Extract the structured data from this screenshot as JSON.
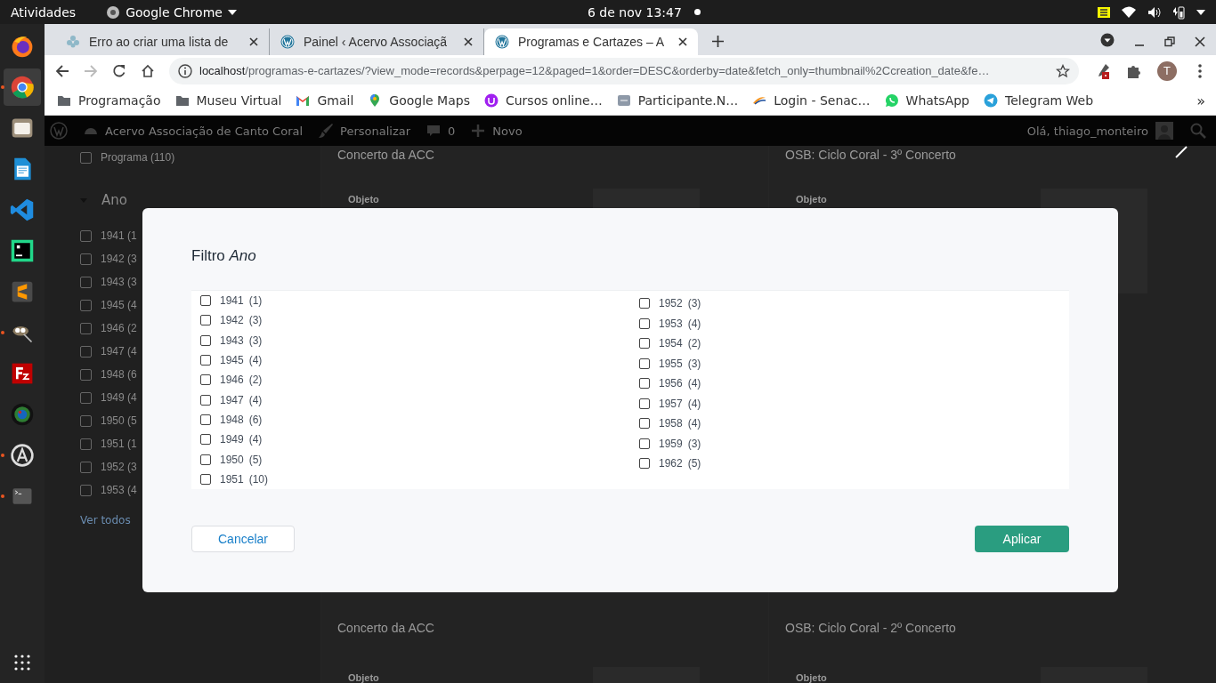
{
  "system_bar": {
    "activities": "Atividades",
    "app_menu": "Google Chrome",
    "clock": "6 de nov  13:47"
  },
  "dock": [
    {
      "kind": "firefox",
      "running": false,
      "selected": false
    },
    {
      "kind": "chrome",
      "running": true,
      "selected": true
    },
    {
      "kind": "files",
      "running": false,
      "selected": false
    },
    {
      "kind": "writer",
      "running": false,
      "selected": false
    },
    {
      "kind": "vscode",
      "running": false,
      "selected": false
    },
    {
      "kind": "pycharm",
      "running": false,
      "selected": false
    },
    {
      "kind": "sublime",
      "running": false,
      "selected": false
    },
    {
      "kind": "gimp",
      "running": true,
      "selected": false
    },
    {
      "kind": "filezilla",
      "running": false,
      "selected": false
    },
    {
      "kind": "camera",
      "running": false,
      "selected": false
    },
    {
      "kind": "software",
      "running": true,
      "selected": false
    },
    {
      "kind": "terminal",
      "running": true,
      "selected": false
    }
  ],
  "tabs": [
    {
      "kind": "flower",
      "title": "Erro ao criar uma lista de",
      "selected": false
    },
    {
      "kind": "wordpress",
      "title": "Painel ‹ Acervo Associaçã",
      "selected": false
    },
    {
      "kind": "wordpress",
      "title": "Programas e Cartazes – A",
      "selected": true
    }
  ],
  "toolbar": {
    "url_host": "localhost",
    "url_path": "/programas-e-cartazes/?view_mode=records&perpage=12&paged=1&order=DESC&orderby=date&fetch_only=thumbnail%2Ccreation_date&fe…",
    "profile": "T"
  },
  "bookmarks": [
    {
      "kind": "folder",
      "label": "Programação"
    },
    {
      "kind": "folder",
      "label": "Museu Virtual"
    },
    {
      "kind": "gmail",
      "label": "Gmail"
    },
    {
      "kind": "maps",
      "label": "Google Maps"
    },
    {
      "kind": "course",
      "label": "Cursos online…"
    },
    {
      "kind": "site",
      "label": "Participante.N…"
    },
    {
      "kind": "senac",
      "label": "Login - Senac…"
    },
    {
      "kind": "whatsapp",
      "label": "WhatsApp"
    },
    {
      "kind": "telegram",
      "label": "Telegram Web"
    }
  ],
  "bookmarks_more": "»",
  "admin_bar": {
    "site": "Acervo Associação de Canto Coral",
    "customize": "Personalizar",
    "comments": "0",
    "new": "Novo",
    "greeting": "Olá, thiago_monteiro"
  },
  "sidebar": {
    "program_filter": {
      "label": "Programa (110)",
      "checked": false
    },
    "section": "Ano",
    "expanded": true,
    "years": [
      {
        "label": "1941 (1",
        "checked": false
      },
      {
        "label": "1942 (3",
        "checked": false
      },
      {
        "label": "1943 (3",
        "checked": false
      },
      {
        "label": "1945 (4",
        "checked": false
      },
      {
        "label": "1946 (2",
        "checked": false
      },
      {
        "label": "1947 (4",
        "checked": false
      },
      {
        "label": "1948 (6",
        "checked": false
      },
      {
        "label": "1949 (4",
        "checked": false
      },
      {
        "label": "1950 (5",
        "checked": false
      },
      {
        "label": "1951 (1",
        "checked": false
      },
      {
        "label": "1952 (3",
        "checked": false
      },
      {
        "label": "1953 (4",
        "checked": false
      }
    ],
    "see_all": "Ver todos"
  },
  "cards": [
    {
      "title": "Concerto da ACC",
      "field_label": "Objeto"
    },
    {
      "title": "OSB: Ciclo Coral - 3º Concerto",
      "field_label": "Objeto"
    },
    {
      "title": "Concerto da ACC",
      "field_label": "Objeto"
    },
    {
      "title": "OSB: Ciclo Coral - 2º Concerto",
      "field_label": "Objeto"
    }
  ],
  "modal": {
    "title": "Filtro *Ano*",
    "option_columns": [
      [
        {
          "year": "1941",
          "count": "(1)",
          "checked": false
        },
        {
          "year": "1942",
          "count": "(3)",
          "checked": false
        },
        {
          "year": "1943",
          "count": "(3)",
          "checked": false
        },
        {
          "year": "1945",
          "count": "(4)",
          "checked": false
        },
        {
          "year": "1946",
          "count": "(2)",
          "checked": false
        },
        {
          "year": "1947",
          "count": "(4)",
          "checked": false
        },
        {
          "year": "1948",
          "count": "(6)",
          "checked": false
        },
        {
          "year": "1949",
          "count": "(4)",
          "checked": false
        },
        {
          "year": "1950",
          "count": "(5)",
          "checked": false
        },
        {
          "year": "1951",
          "count": "(10)",
          "checked": false
        }
      ],
      [
        {
          "year": "1952",
          "count": "(3)",
          "checked": false
        },
        {
          "year": "1953",
          "count": "(4)",
          "checked": false
        },
        {
          "year": "1954",
          "count": "(2)",
          "checked": false
        },
        {
          "year": "1955",
          "count": "(3)",
          "checked": false
        },
        {
          "year": "1956",
          "count": "(4)",
          "checked": false
        },
        {
          "year": "1957",
          "count": "(4)",
          "checked": false
        },
        {
          "year": "1958",
          "count": "(4)",
          "checked": false
        },
        {
          "year": "1959",
          "count": "(3)",
          "checked": false
        },
        {
          "year": "1962",
          "count": "(5)",
          "checked": false
        }
      ]
    ],
    "cancel": "Cancelar",
    "apply": "Aplicar"
  }
}
